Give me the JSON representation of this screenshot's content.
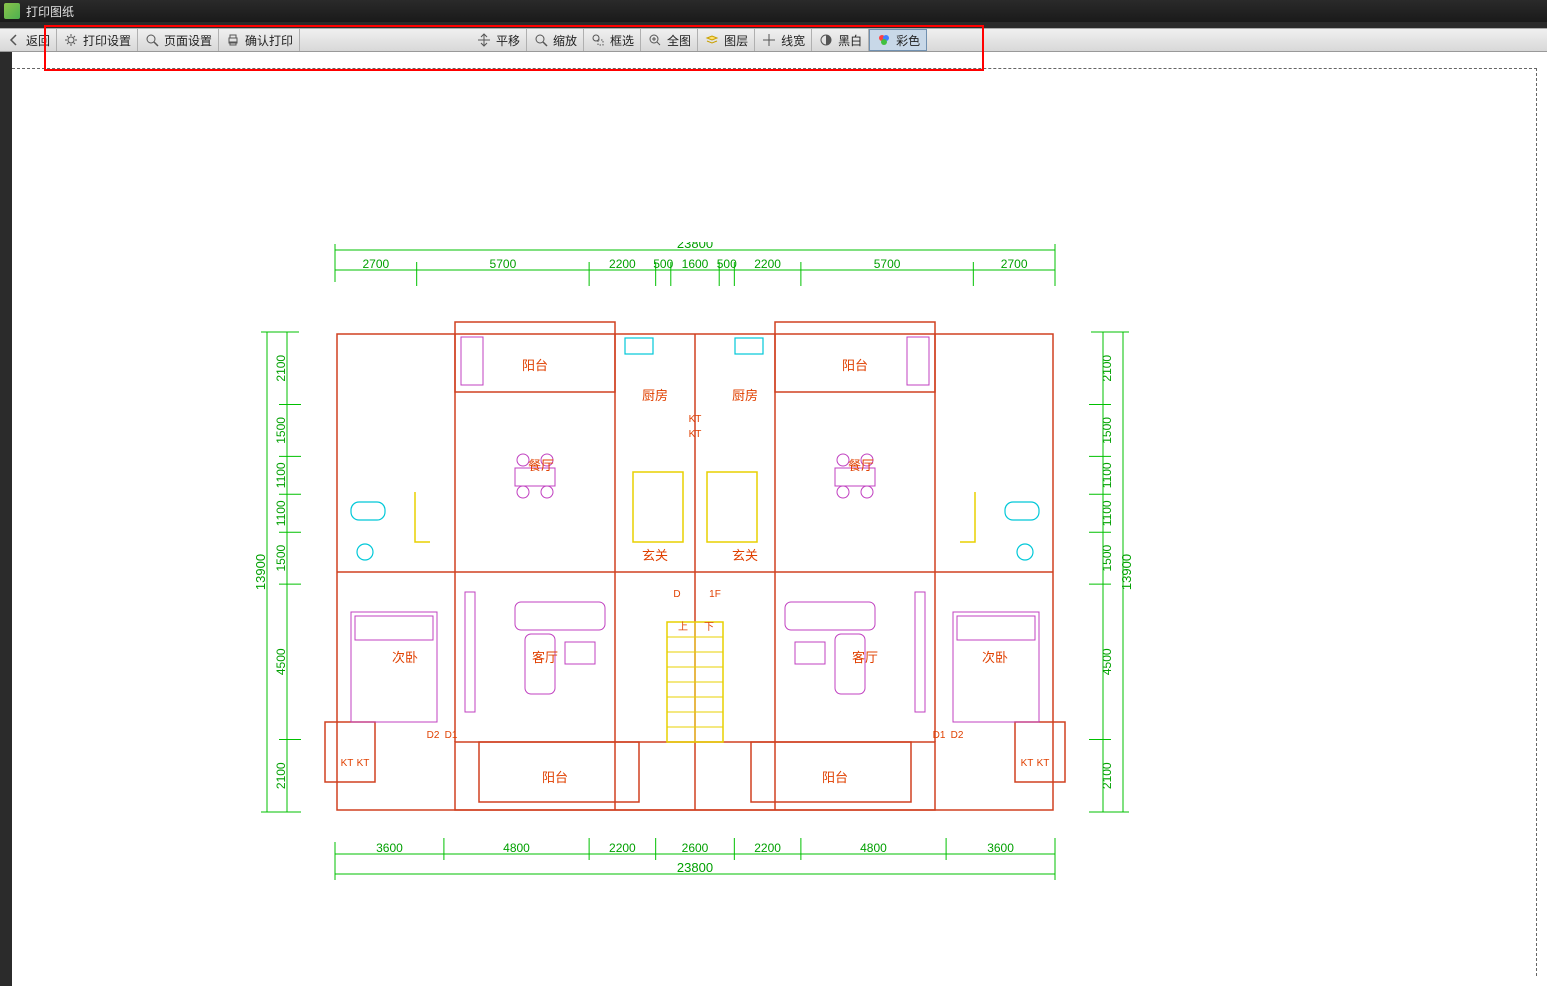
{
  "window": {
    "title": "打印图纸"
  },
  "toolbar": {
    "left": [
      {
        "name": "back-button",
        "label": "返回",
        "icon": "back"
      },
      {
        "name": "print-settings-button",
        "label": "打印设置",
        "icon": "gear"
      },
      {
        "name": "page-settings-button",
        "label": "页面设置",
        "icon": "zoom"
      },
      {
        "name": "confirm-print-button",
        "label": "确认打印",
        "icon": "print"
      }
    ],
    "right": [
      {
        "name": "pan-button",
        "label": "平移",
        "icon": "pan"
      },
      {
        "name": "zoom-button",
        "label": "缩放",
        "icon": "zoom"
      },
      {
        "name": "box-select-button",
        "label": "框选",
        "icon": "box"
      },
      {
        "name": "full-view-button",
        "label": "全图",
        "icon": "full"
      },
      {
        "name": "layers-button",
        "label": "图层",
        "icon": "layers"
      },
      {
        "name": "lineweight-button",
        "label": "线宽",
        "icon": "lineweight"
      },
      {
        "name": "bw-button",
        "label": "黑白",
        "icon": "bw"
      },
      {
        "name": "color-button",
        "label": "彩色",
        "icon": "color",
        "active": true
      }
    ]
  },
  "plan": {
    "total_width": "23800",
    "total_height": "13900",
    "top_segments": [
      "2700",
      "5700",
      "2200",
      "500",
      "1600",
      "500",
      "2200",
      "5700",
      "2700"
    ],
    "bottom_segments": [
      "3600",
      "4800",
      "2200",
      "2600",
      "2200",
      "4800",
      "3600"
    ],
    "left_segments": [
      "2100",
      "1500",
      "1100",
      "1100",
      "1500",
      "4500",
      "2100"
    ],
    "right_segments": [
      "2100",
      "1500",
      "1100",
      "1100",
      "1500",
      "4500",
      "2100"
    ],
    "rooms": {
      "balcony": "阳台",
      "kitchen": "厨房",
      "dining": "餐厅",
      "foyer": "玄关",
      "living": "客厅",
      "sbedroom": "次卧",
      "up": "上",
      "down": "下",
      "kt": "KT",
      "d": "D",
      "f": "1F",
      "d1": "D1",
      "d2": "D2"
    }
  }
}
